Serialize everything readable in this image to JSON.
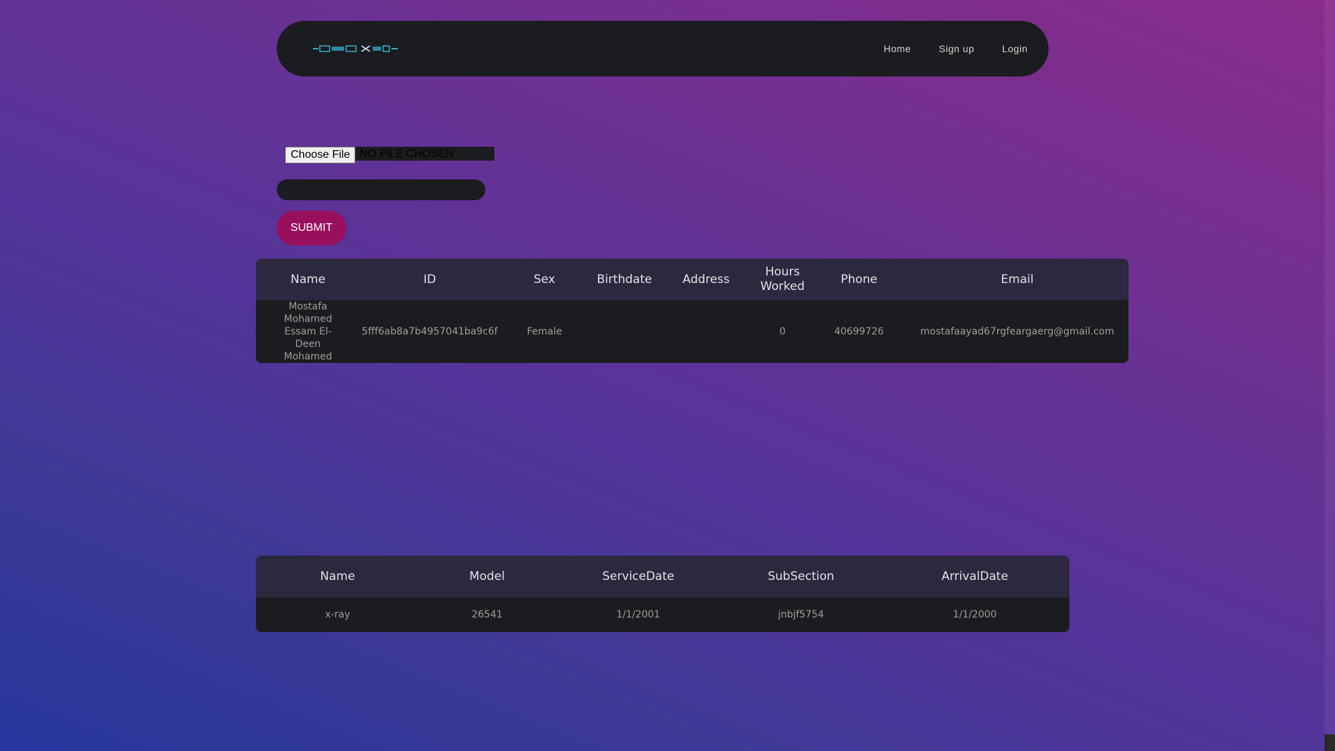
{
  "navbar": {
    "links": [
      "Home",
      "Sign up",
      "Login"
    ]
  },
  "upload": {
    "choose_label": "Choose File",
    "file_status": "NO FILE CHOSEN",
    "text_value": "",
    "submit_label": "SUBMIT"
  },
  "staff_table": {
    "headers": [
      "Name",
      "ID",
      "Sex",
      "Birthdate",
      "Address",
      "Hours Worked",
      "Phone",
      "Email"
    ],
    "rows": [
      [
        "Mostafa Mohamed Essam El-Deen Mohamed",
        "5fff6ab8a7b4957041ba9c6f",
        "Female",
        "",
        "",
        "0",
        "40699726",
        "mostafaayad67rgfeargaerg@gmail.com"
      ]
    ]
  },
  "machine_table": {
    "headers": [
      "Name",
      "Model",
      "ServiceDate",
      "SubSection",
      "ArrivalDate"
    ],
    "rows": [
      [
        "x-ray",
        "26541",
        "1/1/2001",
        "jnbjf5754",
        "1/1/2000"
      ]
    ]
  },
  "colors": {
    "navbar_bg": "#1b1c1f",
    "submit_bg": "#9a0f5d",
    "table_header_bg": "#2b2840",
    "table_row_bg": "#1b1c1f",
    "logo_accent": "#38b2c8"
  },
  "icons": {
    "logo": "radiology-logo"
  }
}
